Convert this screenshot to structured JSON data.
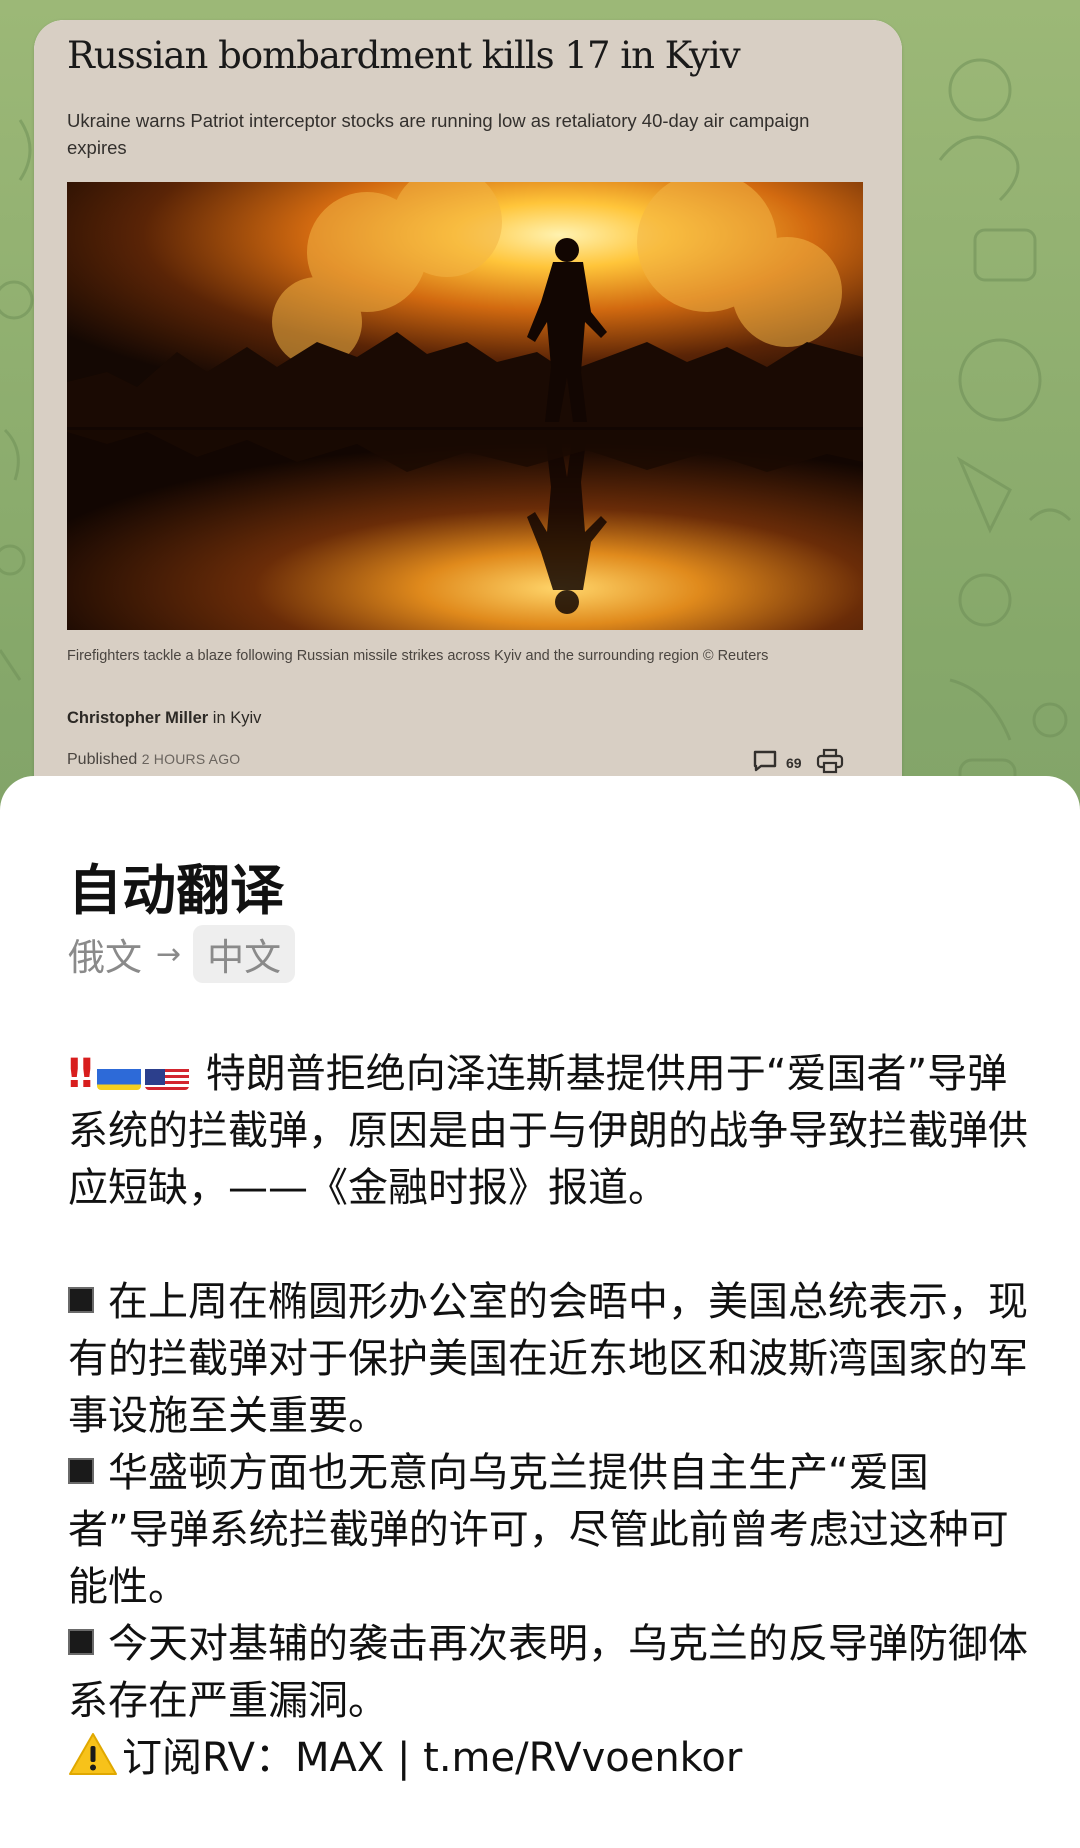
{
  "article": {
    "title": "Russian bombardment kills 17 in Kyiv",
    "subtitle": "Ukraine warns Patriot interceptor stocks are running low as retaliatory 40-day air campaign expires",
    "photo_caption": "Firefighters tackle a blaze following Russian missile strikes across Kyiv and the surrounding region © Reuters",
    "author": "Christopher Miller",
    "author_location": " in Kyiv",
    "published_label": "Published ",
    "published_ago": "2 HOURS AGO",
    "comment_count": "69",
    "icons": [
      "comment-icon",
      "print-icon"
    ]
  },
  "translation_sheet": {
    "title": "自动翻译",
    "source_language": "俄文",
    "arrow": "→",
    "target_language": "中文",
    "headline_alert": "‼",
    "flags": [
      "ukraine-flag",
      "usa-flag"
    ],
    "headline": "特朗普拒绝向泽连斯基提供用于“爱国者”导弹系统的拦截弹，原因是由于与伊朗的战争导致拦截弹供应短缺，——《金融时报》报道。",
    "bullets": [
      "在上周在椭圆形办公室的会晤中，美国总统表示，现有的拦截弹对于保护美国在近东地区和波斯湾国家的军事设施至关重要。",
      "华盛顿方面也无意向乌克兰提供自主生产“爱国者”导弹系统拦截弹的许可，尽管此前曾考虑过这种可能性。",
      "今天对基辅的袭击再次表明，乌克兰的反导弹防御体系存在严重漏洞。"
    ],
    "subscribe": "订阅RV：MAX | t.me/RVvoenkor",
    "subscribe_icon": "warning-icon"
  },
  "colors": {
    "wallpaper": "#86a86a",
    "article_bg": "#d8cfc4",
    "sheet_bg": "#ffffff",
    "alert_red": "#d81e1e"
  }
}
